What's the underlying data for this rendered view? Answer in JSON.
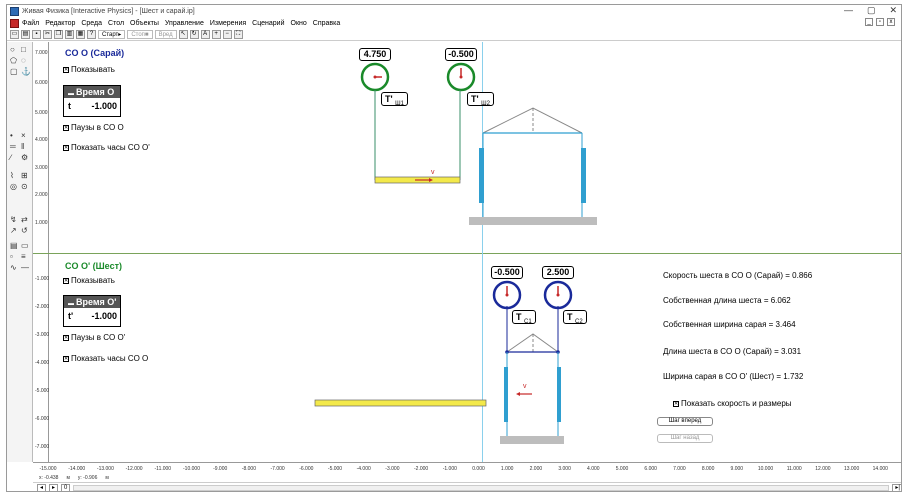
{
  "window": {
    "title": "Живая Физика [Interactive Physics] - [Шест и сарай.ip]",
    "controls": [
      "—",
      "▢",
      "✕"
    ]
  },
  "menu": [
    "Файл",
    "Редактор",
    "Среда",
    "Стол",
    "Объекты",
    "Управление",
    "Измерения",
    "Сценарий",
    "Окно",
    "Справка"
  ],
  "toolbar": {
    "start_label": "Старт▸",
    "stop_label": "Стоп■",
    "reset_label": "Вред"
  },
  "top_frame": {
    "title": "CO O (Сарай)",
    "show_label": "Показывать",
    "meter_title": "Время O",
    "meter_var": "t",
    "meter_value": "-1.000",
    "pauses_label": "Паузы в CO O",
    "show_clocks_label": "Показать часы CO O'",
    "clock1_value": "4.750",
    "clock2_value": "-0.500",
    "clock1_tag": "T'",
    "clock1_sub": "Ш1",
    "clock2_tag": "T'",
    "clock2_sub": "Ш2",
    "velocity_label": "v",
    "y_ticks": [
      "7.000",
      "6.000",
      "5.000",
      "4.000",
      "3.000",
      "2.000",
      "1.000"
    ]
  },
  "bottom_frame": {
    "title": "CO O' (Шест)",
    "show_label": "Показывать",
    "meter_title": "Время O'",
    "meter_var": "t'",
    "meter_value": "-1.000",
    "pauses_label": "Паузы в CO O'",
    "show_clocks_label": "Показать часы CO O",
    "clock1_value": "-0.500",
    "clock2_value": "2.500",
    "clock1_tag": "T",
    "clock1_sub": "C1",
    "clock2_tag": "T",
    "clock2_sub": "C2",
    "velocity_label": "v",
    "y_ticks": [
      "-1.000",
      "-2.000",
      "-3.000",
      "-4.000",
      "-5.000",
      "-6.000",
      "-7.000"
    ]
  },
  "info": {
    "speed": "Скорость шеста в CO O (Сарай) = 0.866",
    "pole_proper": "Собственная длина шеста = 6.062",
    "barn_proper": "Собственная  ширина сарая = 3.464",
    "pole_in_O": "Длина шеста в CO O (Сарай) = 3.031",
    "barn_in_O1": "Ширина сарая в CO O' (Шест) = 1.732",
    "show_speed_label": "Показать скорость и размеры",
    "step_forward": "Шаг вперед",
    "step_back": "Шаг назад"
  },
  "x_ticks": [
    "-15.000",
    "-14.000",
    "-13.000",
    "-12.000",
    "-11.000",
    "-10.000",
    "-9.000",
    "-8.000",
    "-7.000",
    "-6.000",
    "-5.000",
    "-4.000",
    "-3.000",
    "-2.000",
    "-1.000",
    "0.000",
    "1.000",
    "2.000",
    "3.000",
    "4.000",
    "5.000",
    "6.000",
    "7.000",
    "8.000",
    "9.000",
    "10.000",
    "11.000",
    "12.000",
    "13.000",
    "14.000",
    "15.000"
  ],
  "status": {
    "x": "x: -0.438",
    "y": "y: -0.906",
    "unit": "м",
    "frame": "0"
  },
  "colors": {
    "green_clock": "#1a8a2a",
    "blue_clock": "#1a2a9a",
    "pole": "#f3e94a",
    "door": "#2f9fd0",
    "ground": "#bdbdbd",
    "hand": "#c62828",
    "divider": "#7aa35a"
  }
}
